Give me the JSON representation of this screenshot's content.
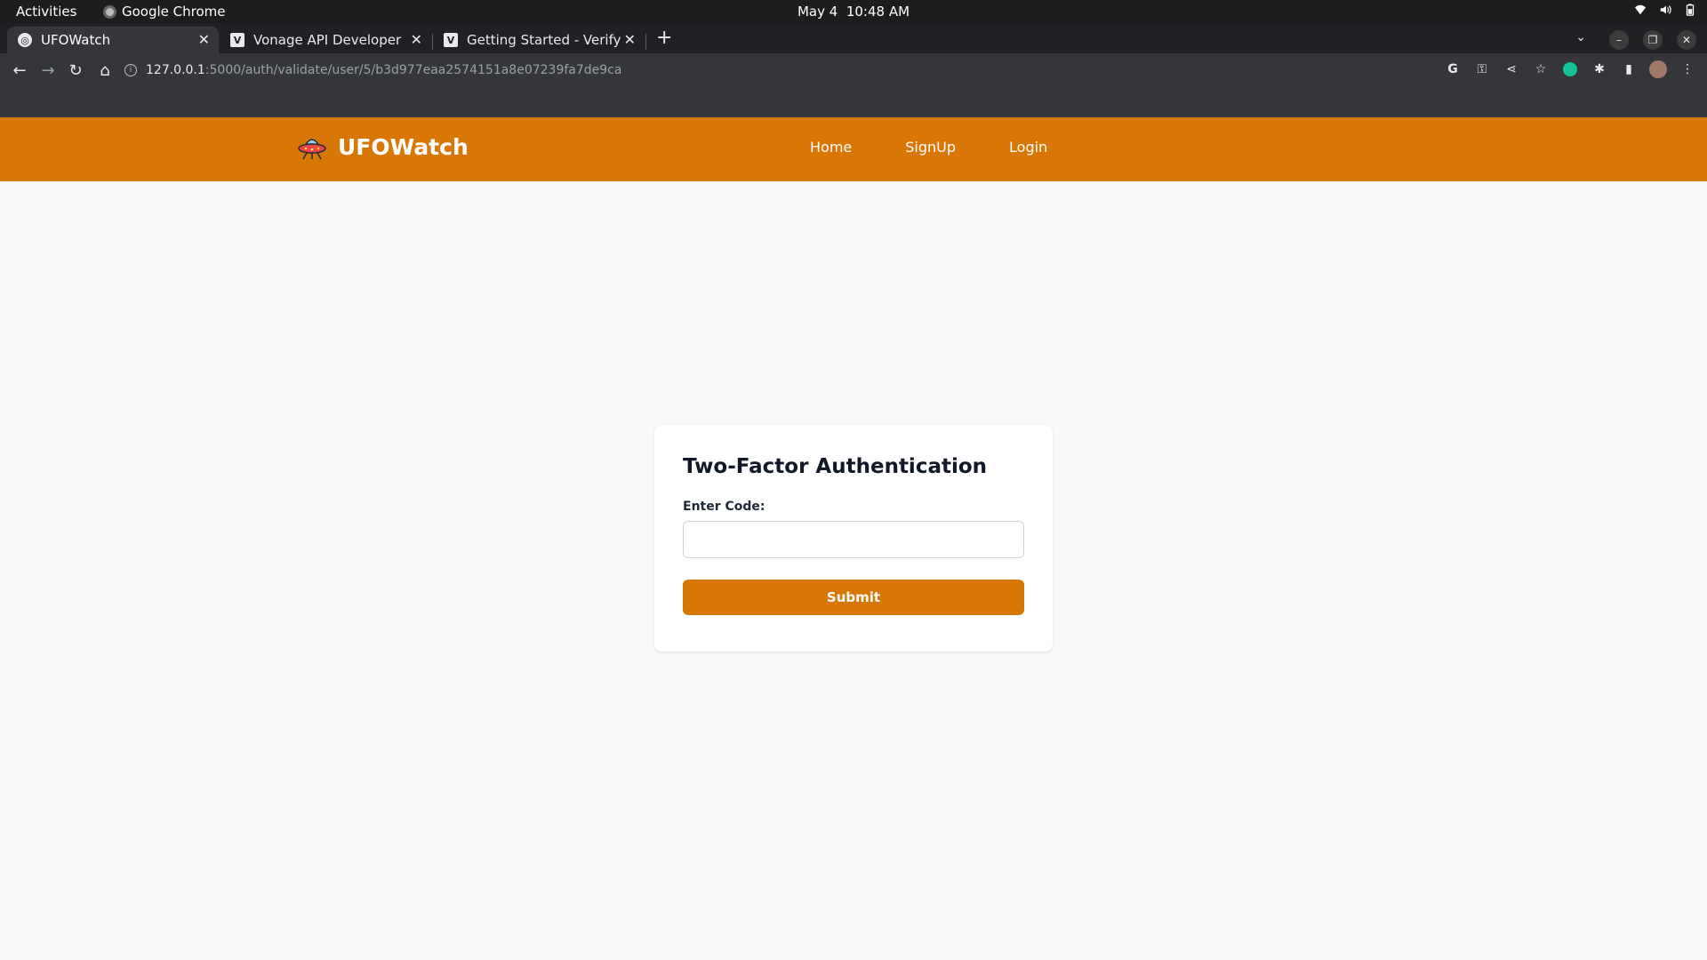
{
  "os_bar": {
    "activities": "Activities",
    "app_name": "Google Chrome",
    "date": "May 4",
    "time": "10:48 AM"
  },
  "browser": {
    "tabs": [
      {
        "title": "UFOWatch",
        "favicon": "globe-icon",
        "active": true
      },
      {
        "title": "Vonage API Developer",
        "favicon": "vonage-v-icon",
        "active": false
      },
      {
        "title": "Getting Started - Verify",
        "favicon": "vonage-v-icon",
        "active": false
      }
    ],
    "url_host": "127.0.0.1",
    "url_path": ":5000/auth/validate/user/5/b3d977eaa2574151a8e07239fa7de9ca"
  },
  "site": {
    "brand": "UFOWatch",
    "nav": {
      "home": "Home",
      "signup": "SignUp",
      "login": "Login"
    },
    "accent_color": "#d97706"
  },
  "auth_form": {
    "title": "Two-Factor Authentication",
    "code_label": "Enter Code:",
    "code_value": "",
    "code_placeholder": "",
    "submit_label": "Submit"
  }
}
